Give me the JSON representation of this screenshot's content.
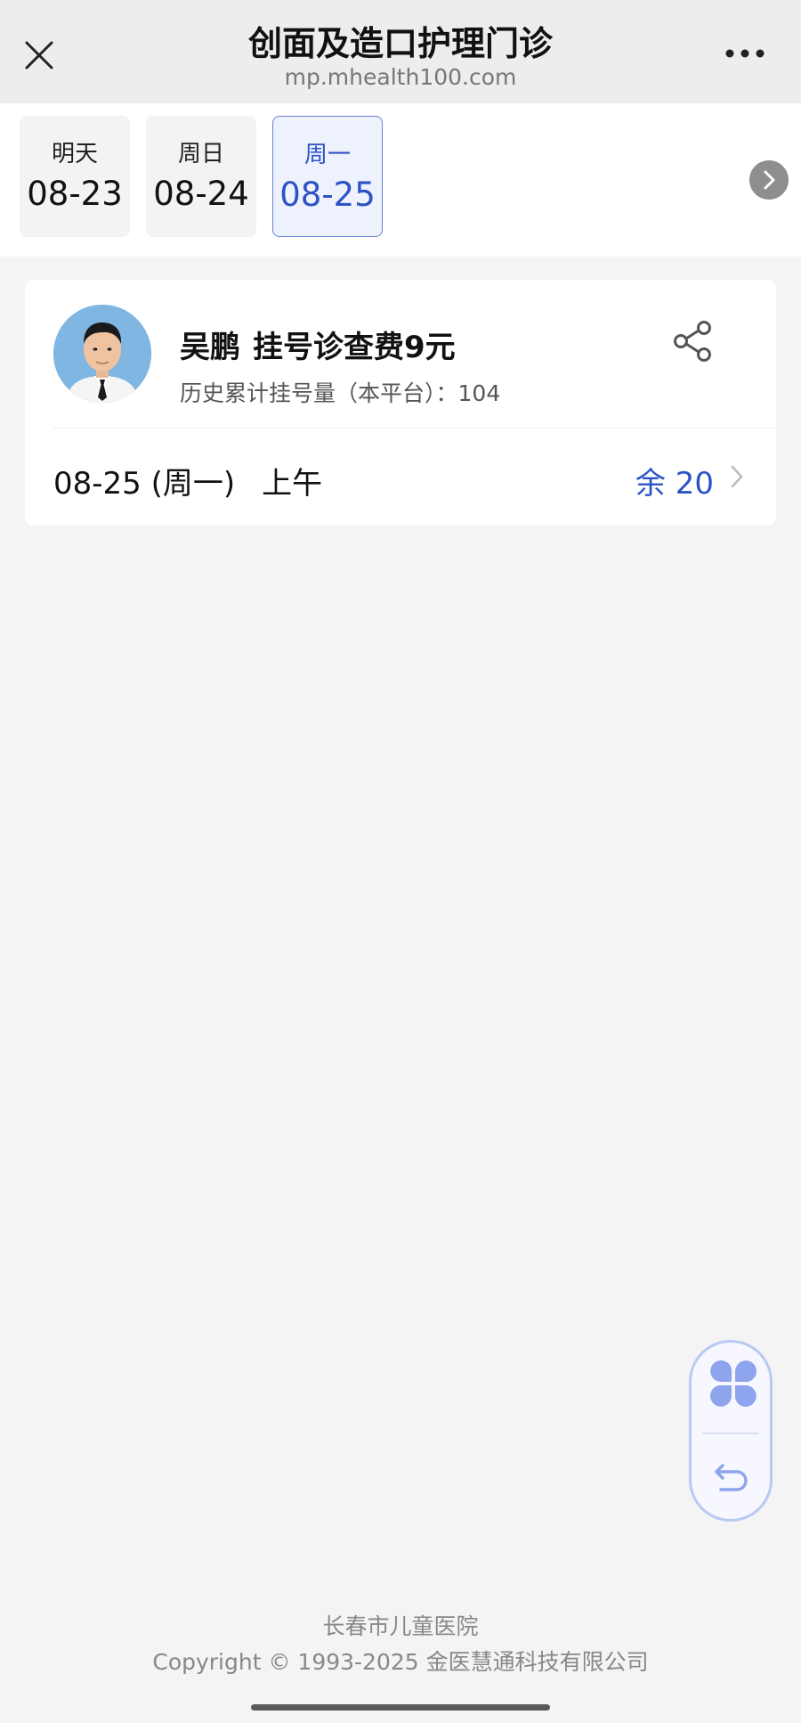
{
  "header": {
    "title": "创面及造口护理门诊",
    "url": "mp.mhealth100.com"
  },
  "date_tabs": [
    {
      "weekday": "明天",
      "date": "08-23",
      "selected": false
    },
    {
      "weekday": "周日",
      "date": "08-24",
      "selected": false
    },
    {
      "weekday": "周一",
      "date": "08-25",
      "selected": true
    }
  ],
  "doctor": {
    "name": "吴鹏",
    "fee": "挂号诊查费9元",
    "history": "历史累计挂号量（本平台）：104",
    "slot": {
      "date": "08-25 (周一)",
      "period": "上午",
      "remaining": "余 20"
    }
  },
  "footer": {
    "hospital": "长春市儿童医院",
    "copyright": "Copyright © 1993-2025 金医慧通科技有限公司"
  },
  "colors": {
    "accent": "#2c53c4",
    "selected_tab_bg": "#eef2fd",
    "page_bg": "#f4f4f4"
  }
}
